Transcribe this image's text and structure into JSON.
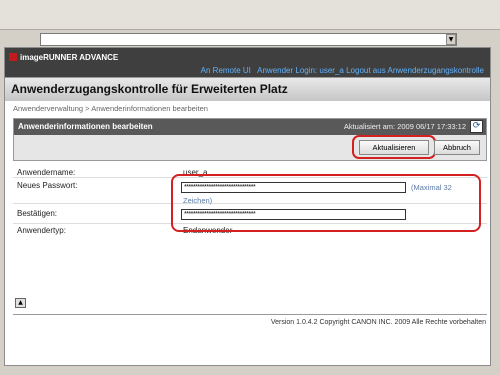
{
  "browser": {
    "address_value": ""
  },
  "header": {
    "logo": "imageRUNNER ADVANCE",
    "remote_ui": "An Remote UI",
    "login_prefix": "Anwender Login: user_a",
    "logout": "Logout aus Anwenderzugangskontrolle",
    "title": "Anwenderzugangskontrolle für Erweiterten Platz"
  },
  "breadcrumb": {
    "item1": "Anwenderverwaltung",
    "separator": ">",
    "item2": "Anwenderinformationen bearbeiten"
  },
  "panel": {
    "title": "Anwenderinformationen bearbeiten",
    "updated": "Aktualisiert am: 2009 06/17 17:33:12",
    "apply_label": "Aktualisieren",
    "cancel_label": "Abbruch"
  },
  "form": {
    "username_label": "Anwendername:",
    "username_value": "user_a",
    "new_password_label": "Neues Passwort:",
    "new_password_value": "********************************",
    "new_password_hint1": "(Maximal 32",
    "new_password_hint2": "Zeichen)",
    "confirm_label": "Bestätigen:",
    "confirm_value": "********************************",
    "type_label": "Anwendertyp:",
    "type_value": "Endanwender"
  },
  "footer": {
    "text": "Version 1.0.4.2 Copyright CANON INC. 2009 Alle Rechte vorbehalten"
  },
  "colors": {
    "highlight_ring": "#d32020",
    "header_bg": "#3f3f3f",
    "header_link": "#5fb3ff"
  }
}
